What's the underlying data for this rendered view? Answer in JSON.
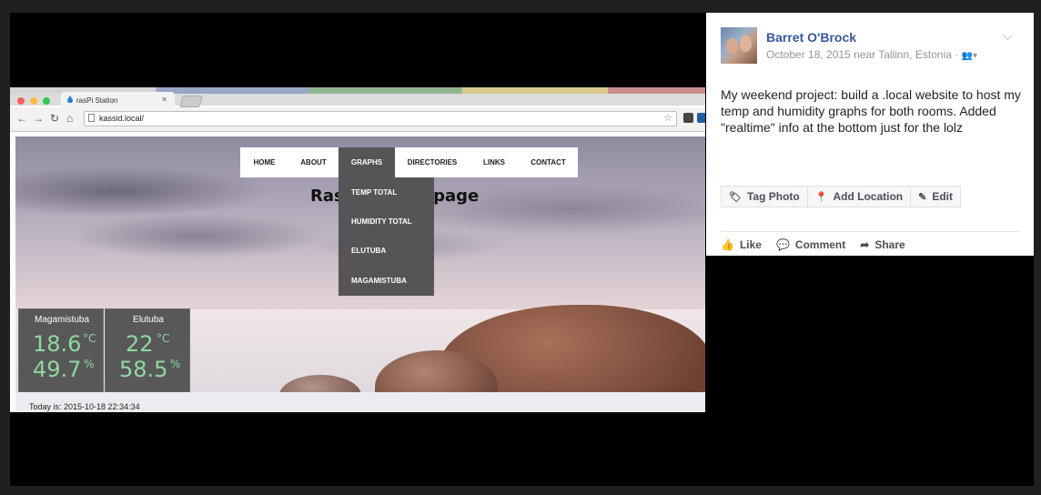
{
  "browser": {
    "tab_title": "rasPi Station",
    "url": "kassid.local/"
  },
  "site": {
    "headline_start": "Ras",
    "headline_end": "omepage",
    "menu": [
      "HOME",
      "ABOUT",
      "GRAPHS",
      "DIRECTORIES",
      "LINKS",
      "CONTACT"
    ],
    "active_menu": "GRAPHS",
    "dropdown": [
      "TEMP TOTAL",
      "HUMIDITY TOTAL",
      "ELUTUBA",
      "MAGAMISTUBA"
    ],
    "sensors": [
      {
        "name": "Magamistuba",
        "temp": "18.6",
        "temp_unit": "°C",
        "humidity": "49.7",
        "humidity_unit": "%"
      },
      {
        "name": "Elutuba",
        "temp": "22",
        "temp_unit": "°C",
        "humidity": "58.5",
        "humidity_unit": "%"
      }
    ],
    "date_line": "Today is: 2015-10-18 22:34:34"
  },
  "post": {
    "author": "Barret O'Brock",
    "meta": "October 18, 2015 near Tallinn, Estonia ·",
    "text": "My weekend project: build a .local website to host my temp and humidity graphs for both rooms. Added \"realtime\" info at the bottom just for the lolz",
    "buttons": {
      "tag": "Tag Photo",
      "location": "Add Location",
      "edit": "Edit"
    },
    "actions": {
      "like": "Like",
      "comment": "Comment",
      "share": "Share"
    }
  },
  "colors": {
    "fb_link": "#365899",
    "sensor_value": "#8fd8a0",
    "dropdown_bg": "#555555"
  }
}
